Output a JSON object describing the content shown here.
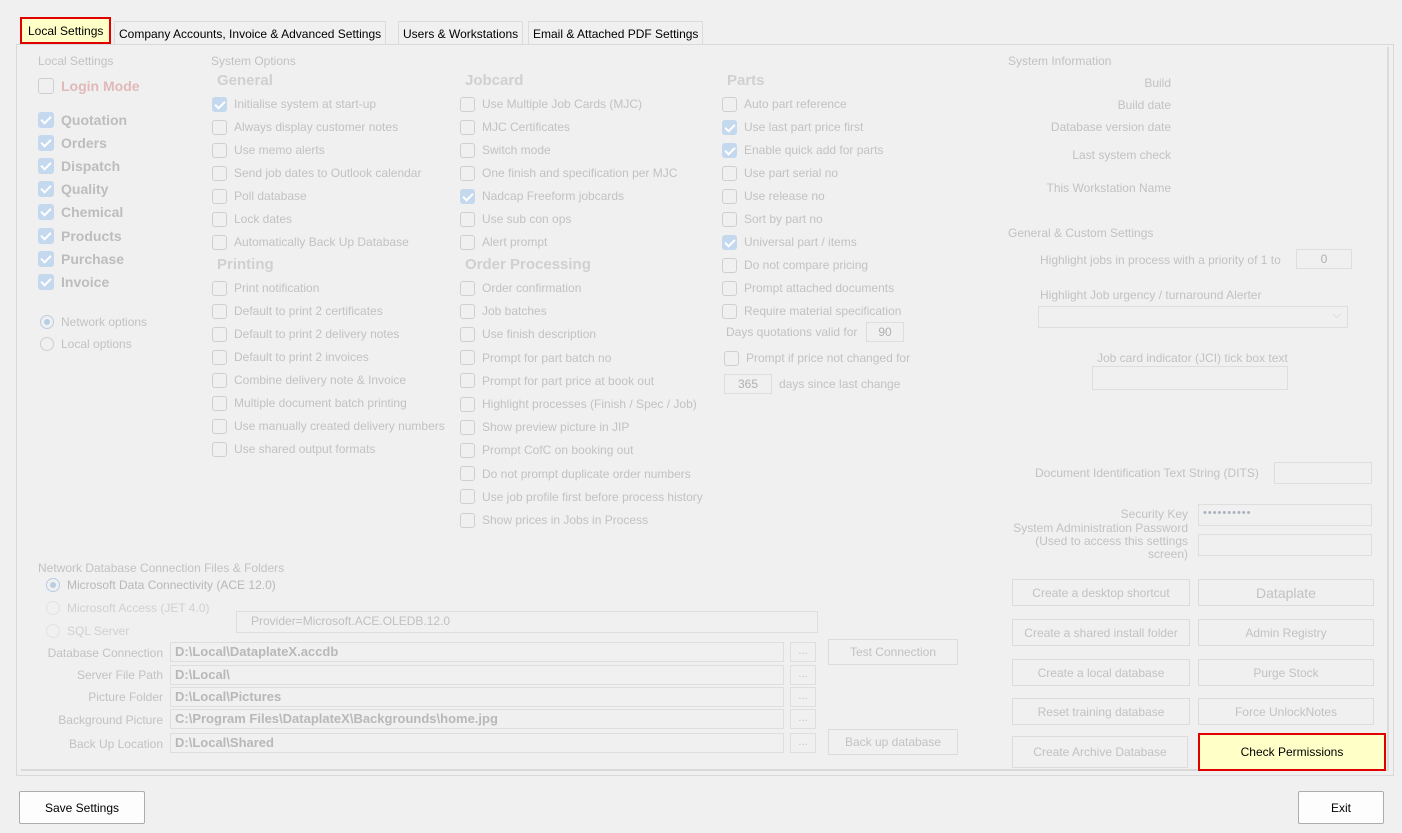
{
  "tabs": [
    {
      "label": "Local Settings"
    },
    {
      "label": "Company Accounts, Invoice & Advanced Settings"
    },
    {
      "label": "Users & Workstations"
    },
    {
      "label": "Email & Attached PDF Settings"
    }
  ],
  "local_settings": {
    "title": "Local Settings",
    "login_mode": "Login Mode",
    "modules": [
      {
        "label": "Quotation",
        "checked": true
      },
      {
        "label": "Orders",
        "checked": true
      },
      {
        "label": "Dispatch",
        "checked": true
      },
      {
        "label": "Quality",
        "checked": true
      },
      {
        "label": "Chemical",
        "checked": true
      },
      {
        "label": "Products",
        "checked": true
      },
      {
        "label": "Purchase",
        "checked": true
      },
      {
        "label": "Invoice",
        "checked": true
      }
    ],
    "network_options": "Network options",
    "local_options": "Local options"
  },
  "system_options": {
    "title": "System Options",
    "general_header": "General",
    "general": [
      {
        "label": "Initialise system at start-up",
        "checked": true
      },
      {
        "label": "Always display customer notes",
        "checked": false
      },
      {
        "label": "Use memo alerts",
        "checked": false
      },
      {
        "label": "Send job dates to Outlook calendar",
        "checked": false
      },
      {
        "label": "Poll database",
        "checked": false
      },
      {
        "label": "Lock dates",
        "checked": false
      },
      {
        "label": "Automatically Back Up Database",
        "checked": false
      }
    ],
    "printing_header": "Printing",
    "printing": [
      {
        "label": "Print notification",
        "checked": false
      },
      {
        "label": "Default to print 2 certificates",
        "checked": false
      },
      {
        "label": "Default to print 2 delivery notes",
        "checked": false
      },
      {
        "label": "Default to print 2 invoices",
        "checked": false
      },
      {
        "label": "Combine delivery note & Invoice",
        "checked": false
      },
      {
        "label": "Multiple document batch printing",
        "checked": false
      },
      {
        "label": "Use manually created delivery numbers",
        "checked": false
      },
      {
        "label": "Use shared output formats",
        "checked": false
      }
    ],
    "jobcard_header": "Jobcard",
    "jobcard": [
      {
        "label": "Use Multiple Job Cards (MJC)",
        "checked": false
      },
      {
        "label": "MJC Certificates",
        "checked": false
      },
      {
        "label": "Switch mode",
        "checked": false
      },
      {
        "label": "One finish and specification per MJC",
        "checked": false
      },
      {
        "label": "Nadcap Freeform jobcards",
        "checked": true
      },
      {
        "label": "Use sub con ops",
        "checked": false
      },
      {
        "label": "Alert prompt",
        "checked": false
      }
    ],
    "order_header": "Order Processing",
    "order": [
      {
        "label": "Order confirmation",
        "checked": false
      },
      {
        "label": "Job batches",
        "checked": false
      },
      {
        "label": "Use finish description",
        "checked": false
      },
      {
        "label": "Prompt for part batch no",
        "checked": false
      },
      {
        "label": "Prompt for part price at book out",
        "checked": false
      },
      {
        "label": "Highlight processes (Finish / Spec / Job)",
        "checked": false
      },
      {
        "label": "Show preview picture in JIP",
        "checked": false
      },
      {
        "label": "Prompt CofC on booking out",
        "checked": false
      },
      {
        "label": "Do not prompt duplicate order numbers",
        "checked": false
      },
      {
        "label": "Use job profile first before process history",
        "checked": false
      },
      {
        "label": "Show prices in Jobs in Process",
        "checked": false
      }
    ],
    "parts_header": "Parts",
    "parts": [
      {
        "label": "Auto part reference",
        "checked": false
      },
      {
        "label": "Use last part price first",
        "checked": true
      },
      {
        "label": "Enable quick add for parts",
        "checked": true
      },
      {
        "label": "Use part serial no",
        "checked": false
      },
      {
        "label": "Use release no",
        "checked": false
      },
      {
        "label": "Sort by part no",
        "checked": false
      },
      {
        "label": "Universal part / items",
        "checked": true
      },
      {
        "label": "Do not compare pricing",
        "checked": false
      },
      {
        "label": "Prompt attached documents",
        "checked": false
      },
      {
        "label": "Require material specification",
        "checked": false
      }
    ],
    "days_valid_label": "Days quotations valid for",
    "days_valid_value": "90",
    "prompt_price_label": "Prompt if price not changed for",
    "days_since_value": "365",
    "days_since_label": "days since last change"
  },
  "system_info": {
    "title": "System Information",
    "build": "Build",
    "build_date": "Build date",
    "db_version_date": "Database version date",
    "last_check": "Last system check",
    "workstation": "This Workstation Name",
    "custom_title": "General & Custom Settings",
    "highlight_label": "Highlight jobs in process with a priority of 1 to",
    "highlight_value": "0",
    "urgency_label": "Highlight Job urgency / turnaround Alerter",
    "jci_label": "Job card indicator (JCI) tick box text",
    "dits_label": "Document Identification Text String (DITS)",
    "security_key_label": "Security Key",
    "security_key_value": "••••••••••",
    "admin_pw_label_1": "System Administration Password",
    "admin_pw_label_2": "(Used to access this settings",
    "admin_pw_label_3": "screen)"
  },
  "buttons": {
    "desktop_shortcut": "Create a desktop shortcut",
    "dataplate": "Dataplate",
    "shared_install": "Create a shared install folder",
    "admin_registry": "Admin Registry",
    "local_db": "Create a local database",
    "purge_stock": "Purge Stock",
    "reset_training": "Reset training database",
    "force_unlock": "Force UnlockNotes",
    "archive_db": "Create Archive Database",
    "check_permissions": "Check Permissions",
    "test_connection": "Test Connection",
    "backup_db": "Back up database",
    "ellipsis": "...",
    "save_settings": "Save Settings",
    "exit": "Exit"
  },
  "network": {
    "title": "Network Database Connection Files & Folders",
    "ace": "Microsoft Data Connectivity (ACE 12.0)",
    "jet": "Microsoft Access  (JET 4.0)",
    "sql": "SQL Server",
    "provider": "Provider=Microsoft.ACE.OLEDB.12.0",
    "db_conn_label": "Database Connection",
    "db_conn_value": "D:\\Local\\DataplateX.accdb",
    "server_path_label": "Server File Path",
    "server_path_value": "D:\\Local\\",
    "picture_label": "Picture Folder",
    "picture_value": "D:\\Local\\Pictures",
    "background_label": "Background Picture",
    "background_value": "C:\\Program Files\\DataplateX\\Backgrounds\\home.jpg",
    "backup_label": "Back Up Location",
    "backup_value": "D:\\Local\\Shared"
  }
}
